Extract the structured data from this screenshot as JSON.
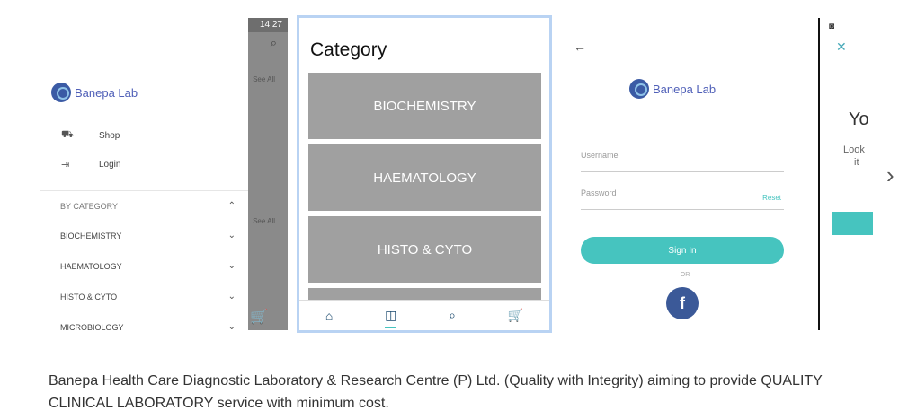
{
  "drawer_screen": {
    "time": "14:27",
    "background": {
      "see_all_1": "See All",
      "see_all_2": "See All"
    },
    "brand": "Banepa Lab",
    "menu": [
      {
        "icon": "shop-icon",
        "label": "Shop"
      },
      {
        "icon": "login-icon",
        "label": "Login"
      }
    ],
    "by_category": "BY CATEGORY",
    "categories": [
      "BIOCHEMISTRY",
      "HAEMATOLOGY",
      "HISTO & CYTO",
      "MICROBIOLOGY"
    ]
  },
  "category_screen": {
    "title": "Category",
    "cards": [
      "BIOCHEMISTRY",
      "HAEMATOLOGY",
      "HISTO & CYTO"
    ],
    "nav": [
      "home-icon",
      "catalog-icon",
      "search-icon",
      "cart-icon"
    ]
  },
  "login_screen": {
    "brand": "Banepa Lab",
    "username_placeholder": "Username",
    "password_placeholder": "Password",
    "reset": "Reset",
    "signin": "Sign In",
    "or": "OR",
    "facebook": "f"
  },
  "partial_screen": {
    "yo": "Yo",
    "look_line1": "Look",
    "look_line2": "it"
  },
  "description": "Banepa Health Care Diagnostic Laboratory & Research Centre (P) Ltd. (Quality with Integrity) aiming to provide QUALITY CLINICAL LABORATORY service with minimum cost.",
  "colors": {
    "teal": "#46c4bf",
    "brand": "#5060b8",
    "card": "#a0a0a0",
    "facebook": "#3b5998"
  }
}
